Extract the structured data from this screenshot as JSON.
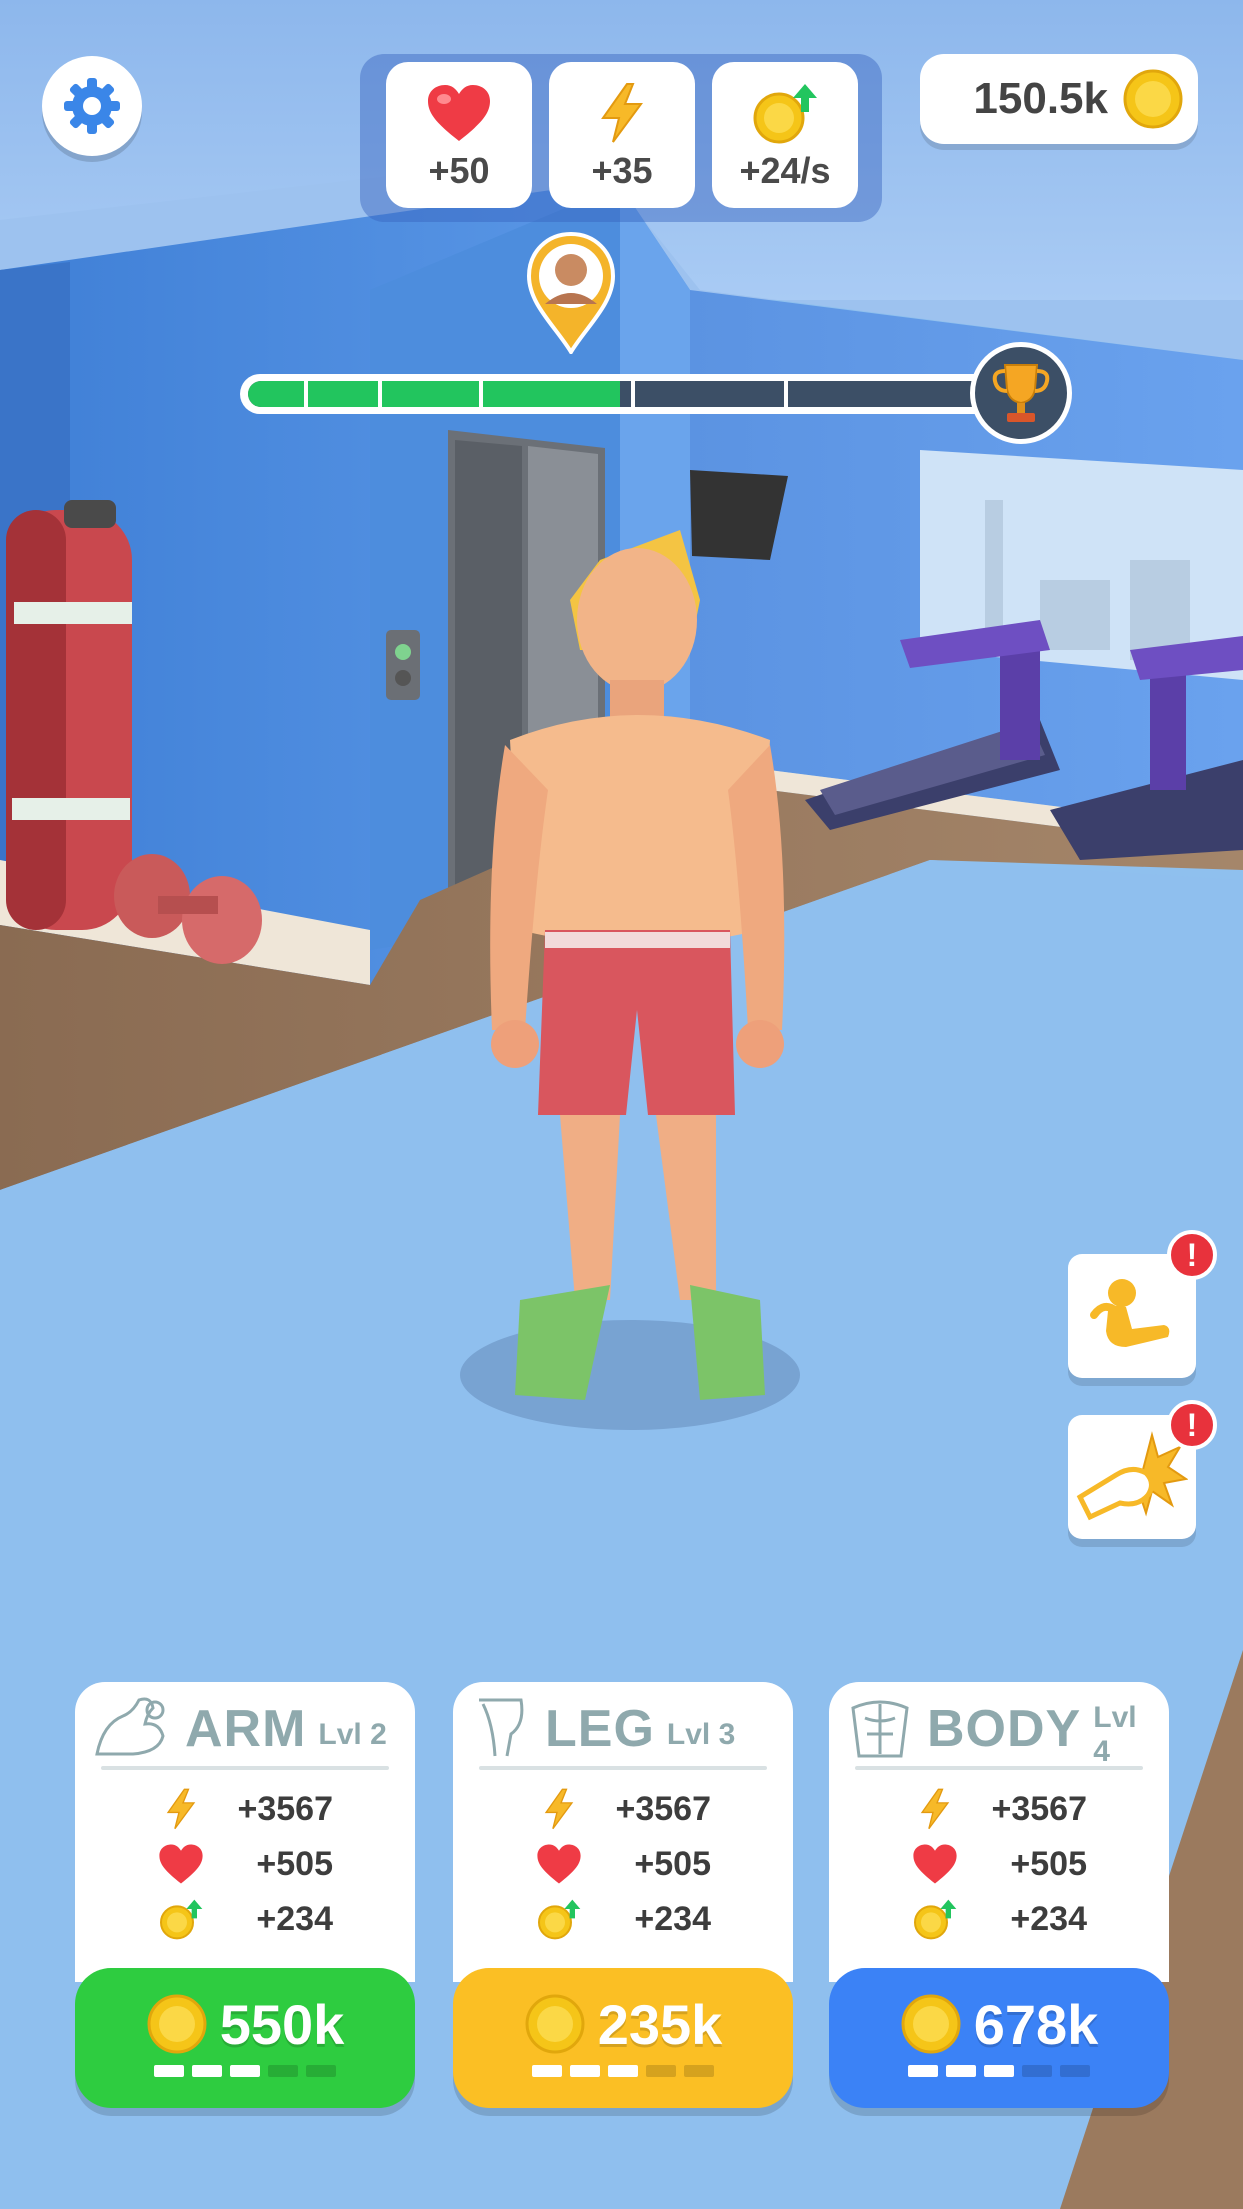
{
  "hud": {
    "settings_icon": "gear-icon",
    "stats": [
      {
        "icon": "heart-icon",
        "value": "+50"
      },
      {
        "icon": "lightning-icon",
        "value": "+35"
      },
      {
        "icon": "coin-up-icon",
        "value": "+24/s"
      }
    ],
    "coins": "150.5k"
  },
  "progress": {
    "segments": 6,
    "completed_segments": 3,
    "goal_icon": "trophy-icon",
    "marker_icon": "opponent-avatar-pin"
  },
  "side_buttons": [
    {
      "icon": "situp-icon",
      "alert": "!"
    },
    {
      "icon": "punch-icon",
      "alert": "!"
    }
  ],
  "cards": [
    {
      "icon": "arm-muscle-icon",
      "title": "ARM",
      "level": "Lvl 2",
      "energy": "+3567",
      "health": "+505",
      "income": "+234",
      "price": "550k",
      "button_color": "#2ecc40",
      "level_segments": 5,
      "level_filled": 3
    },
    {
      "icon": "leg-muscle-icon",
      "title": "LEG",
      "level": "Lvl 3",
      "energy": "+3567",
      "health": "+505",
      "income": "+234",
      "price": "235k",
      "button_color": "#fbbf24",
      "level_segments": 5,
      "level_filled": 3
    },
    {
      "icon": "body-muscle-icon",
      "title": "BODY",
      "level": "Lvl 4",
      "energy": "+3567",
      "health": "+505",
      "income": "+234",
      "price": "678k",
      "button_color": "#3b82f6",
      "level_segments": 5,
      "level_filled": 3
    }
  ],
  "colors": {
    "progress_fill": "#22c55e",
    "alert": "#e8323c",
    "coin": "#f5c518"
  }
}
